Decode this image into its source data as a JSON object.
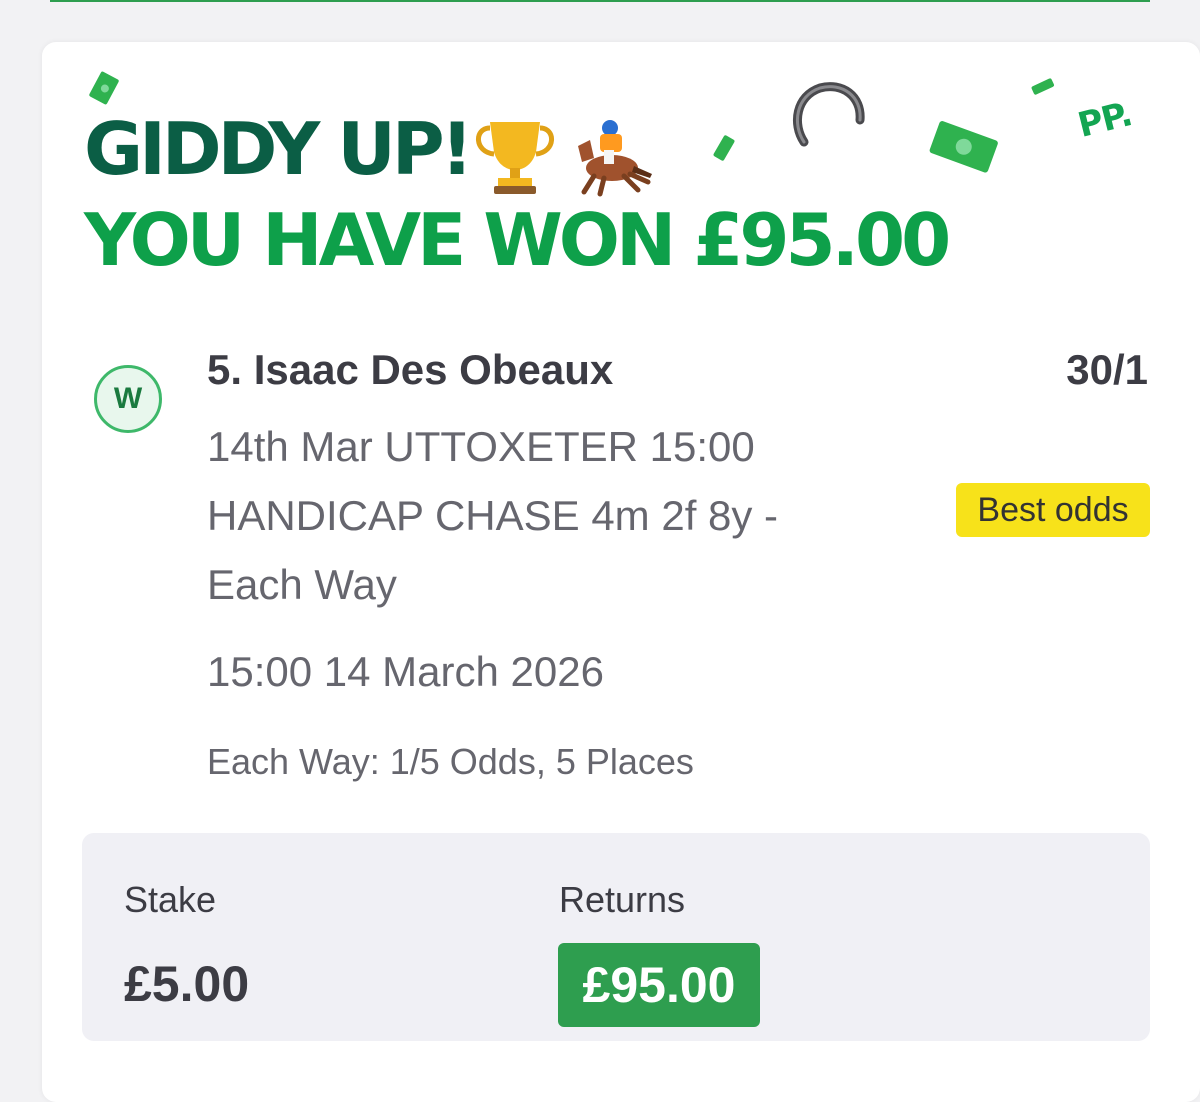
{
  "header": {
    "line1": "GIDDY UP!",
    "line2": "YOU HAVE WON £95.00",
    "brand_mark": "PP.",
    "decorations": [
      "trophy-icon",
      "horse-racing-icon",
      "horseshoe-icon",
      "money-icon"
    ]
  },
  "selection": {
    "result_badge": "W",
    "name": "5. Isaac Des Obeaux",
    "odds": "30/1",
    "market": "14th Mar UTTOXETER 15:00 HANDICAP CHASE 4m 2f 8y - Each Way",
    "best_odds_label": "Best odds",
    "datetime": "15:00 14 March 2026",
    "each_way_terms": "Each Way: 1/5 Odds, 5 Places"
  },
  "summary": {
    "stake_label": "Stake",
    "stake_value": "£5.00",
    "returns_label": "Returns",
    "returns_value": "£95.00"
  },
  "colors": {
    "headline_dark": "#0b5e45",
    "headline_green": "#0ea04a",
    "returns_bg": "#2e9e4f",
    "best_odds_bg": "#f7e21a"
  }
}
